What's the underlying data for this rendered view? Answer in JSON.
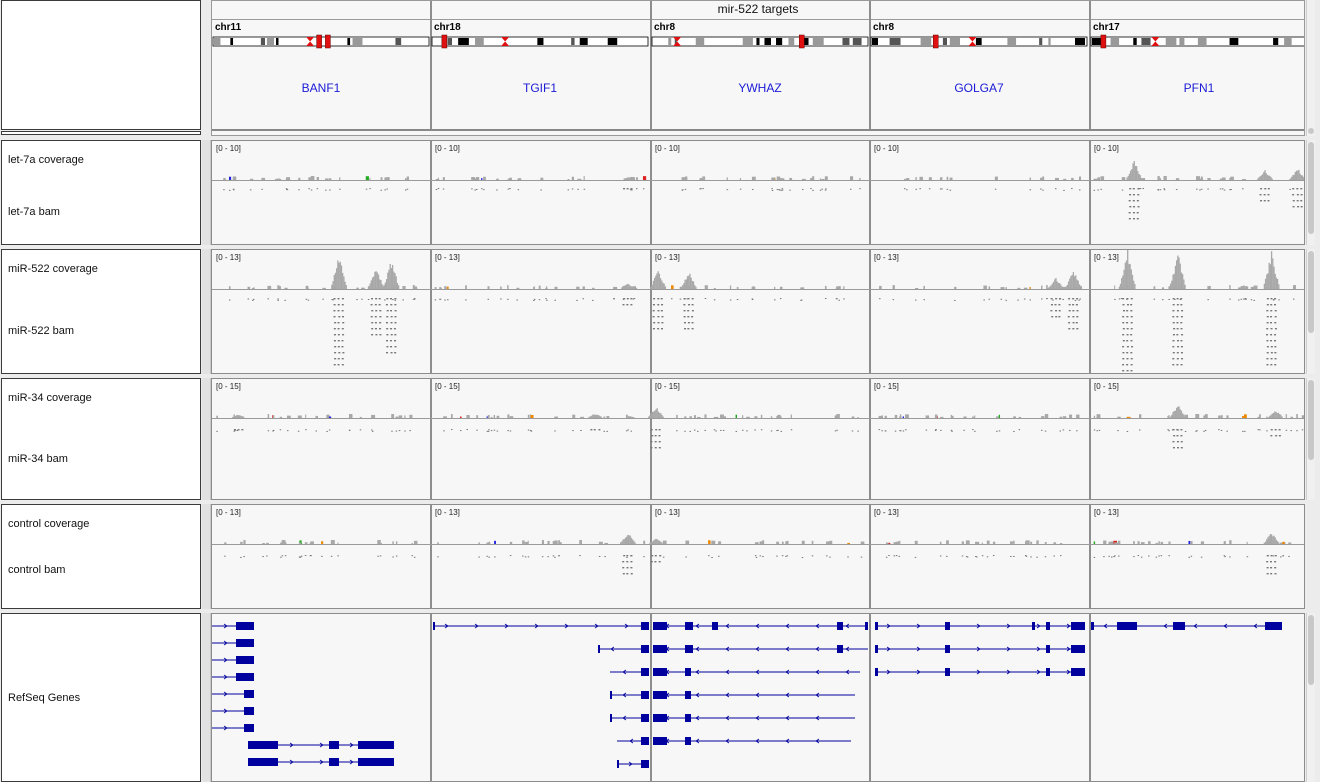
{
  "title": "mir-522 targets",
  "loci": [
    {
      "chr": "chr11",
      "gene": "BANF1"
    },
    {
      "chr": "chr18",
      "gene": "TGIF1"
    },
    {
      "chr": "chr8",
      "gene": "YWHAZ"
    },
    {
      "chr": "chr8",
      "gene": "GOLGA7"
    },
    {
      "chr": "chr17",
      "gene": "PFN1"
    }
  ],
  "panels": [
    {
      "coverage_label": "let-7a coverage",
      "bam_label": "let-7a bam",
      "range": "[0 - 10]"
    },
    {
      "coverage_label": "miR-522 coverage",
      "bam_label": "miR-522 bam",
      "range": "[0 - 13]"
    },
    {
      "coverage_label": "miR-34 coverage",
      "bam_label": "miR-34 bam",
      "range": "[0 - 15]"
    },
    {
      "coverage_label": "control coverage",
      "bam_label": "control bam",
      "range": "[0 - 13]"
    }
  ],
  "refseq_label": "RefSeq Genes",
  "colors": {
    "gene_name": "#1a1ad6",
    "gene_model": "#00009e",
    "coverage": "#a8a8a8",
    "centromere": "#e01010"
  }
}
